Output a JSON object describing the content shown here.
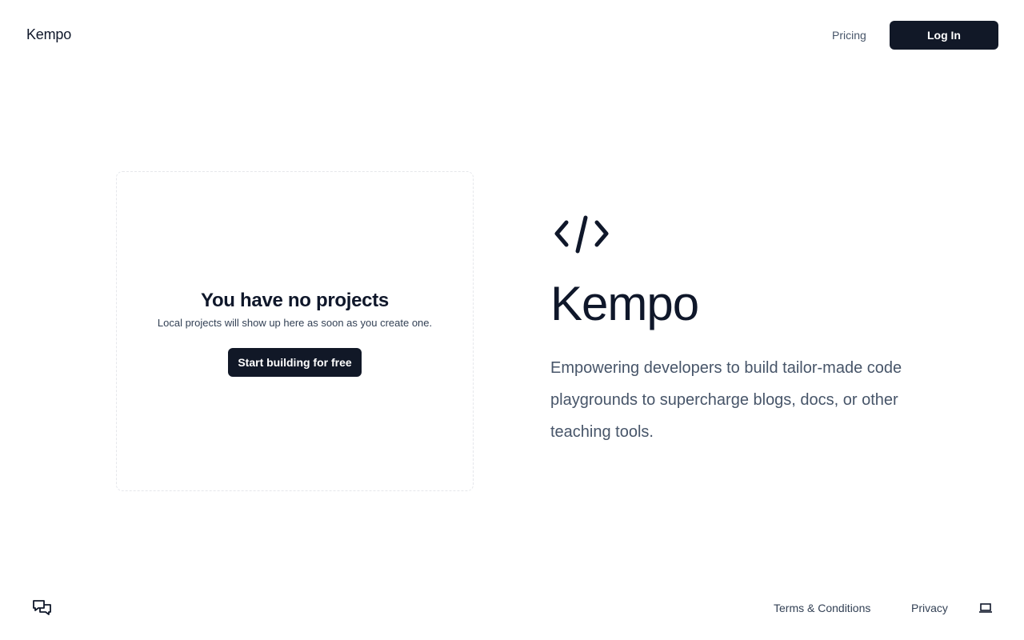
{
  "header": {
    "brand": "Kempo",
    "nav_pricing": "Pricing",
    "login_label": "Log In"
  },
  "empty_state": {
    "title": "You have no projects",
    "subtitle": "Local projects will show up here as soon as you create one.",
    "cta_label": "Start building for free"
  },
  "hero": {
    "icon": "code-brackets-icon",
    "title": "Kempo",
    "description": "Empowering developers to build tailor-made code playgrounds to supercharge blogs, docs, or other teaching tools."
  },
  "footer": {
    "feedback_icon": "chat-bubbles-icon",
    "terms_label": "Terms & Conditions",
    "privacy_label": "Privacy",
    "device_icon": "laptop-icon"
  },
  "colors": {
    "primary_button": "#111827",
    "text_dark": "#0f172a",
    "text_muted": "#475569"
  }
}
